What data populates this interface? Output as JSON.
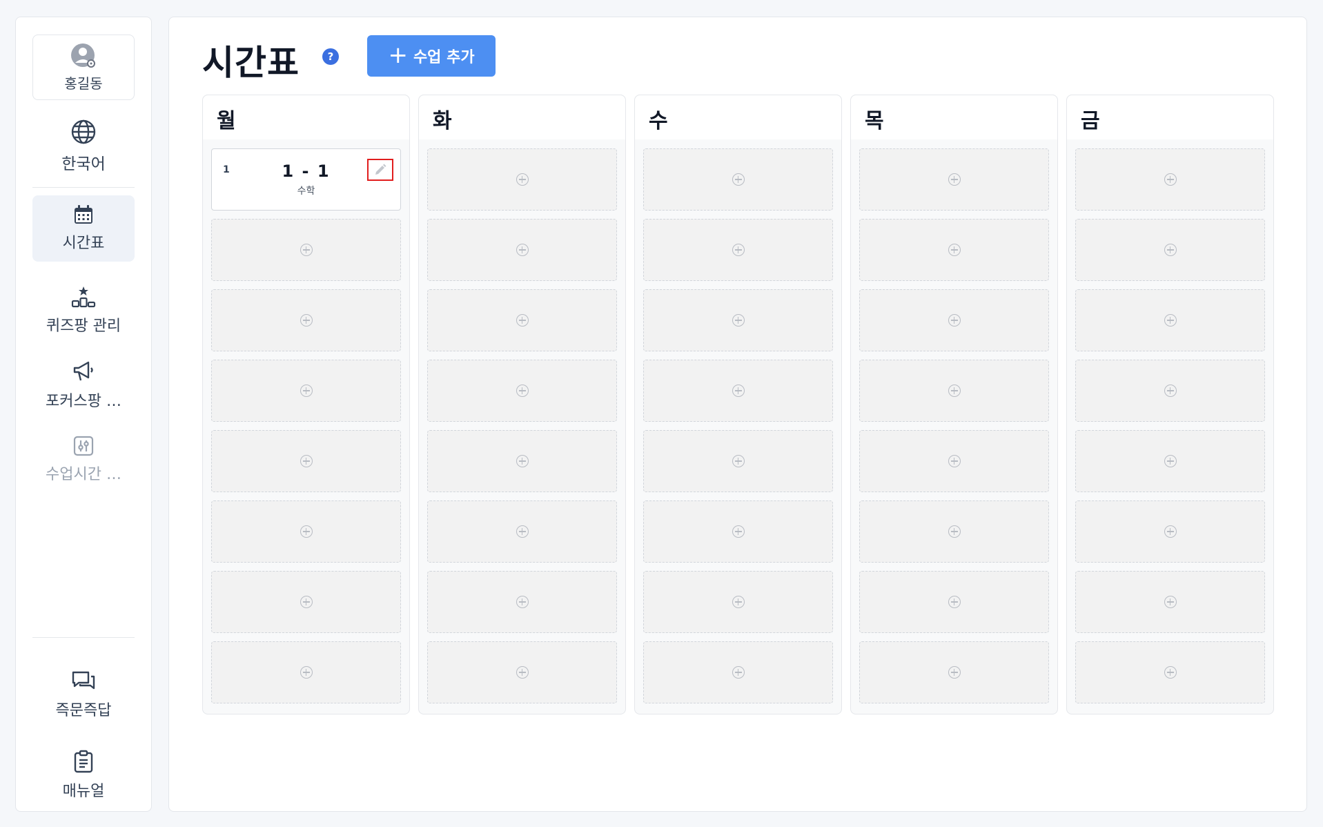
{
  "sidebar": {
    "profile_name": "홍길동",
    "language": "한국어",
    "items": [
      {
        "label": "시간표",
        "icon": "calendar-icon",
        "active": true
      },
      {
        "label": "퀴즈팡 관리",
        "icon": "podium-icon"
      },
      {
        "label": "포커스팡 …",
        "icon": "megaphone-icon"
      },
      {
        "label": "수업시간 …",
        "icon": "sliders-icon",
        "disabled": true
      }
    ],
    "bottom": [
      {
        "label": "즉문즉답",
        "icon": "chat-icon"
      },
      {
        "label": "매뉴얼",
        "icon": "clipboard-icon"
      }
    ]
  },
  "header": {
    "title": "시간표",
    "help": "?",
    "add_button": "수업 추가",
    "add_icon": "+"
  },
  "days": [
    "월",
    "화",
    "수",
    "목",
    "금"
  ],
  "filled_slot": {
    "period": "1",
    "class": "1 - 1",
    "subject": "수학"
  },
  "colors": {
    "accent": "#4d8ff2",
    "help": "#3b6fe0",
    "highlight": "#e11d1d"
  }
}
